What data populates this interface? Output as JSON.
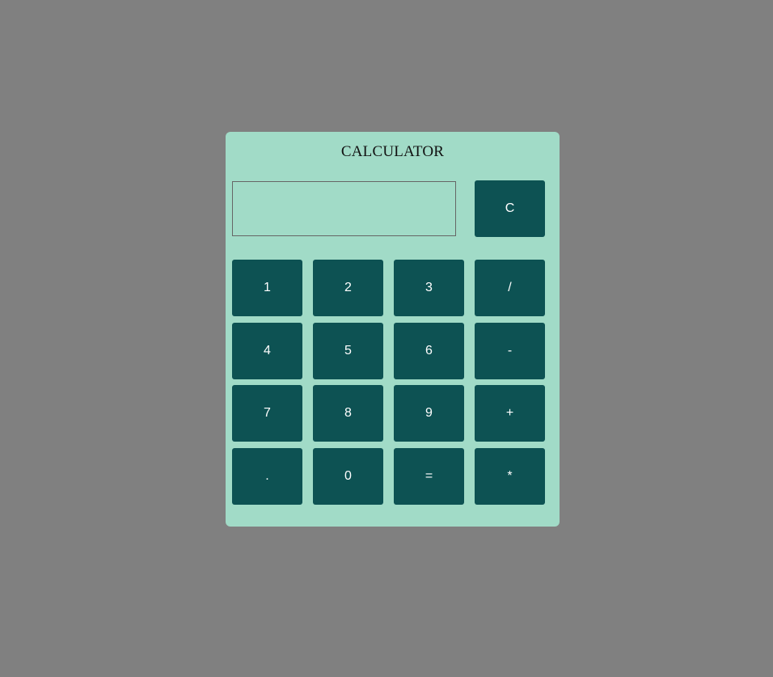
{
  "calculator": {
    "title": "CALCULATOR",
    "display_value": "",
    "clear_label": "C",
    "keys": {
      "one": "1",
      "two": "2",
      "three": "3",
      "divide": "/",
      "four": "4",
      "five": "5",
      "six": "6",
      "minus": "-",
      "seven": "7",
      "eight": "8",
      "nine": "9",
      "plus": "+",
      "decimal": ".",
      "zero": "0",
      "equals": "=",
      "multiply": "*"
    }
  },
  "colors": {
    "page_background": "#808080",
    "panel_background": "#a1dbc7",
    "button_background": "#0d5253",
    "button_text": "#ffffff",
    "title_text": "#111111"
  }
}
